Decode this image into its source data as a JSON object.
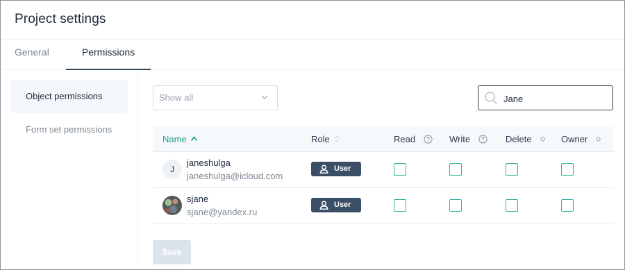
{
  "header": {
    "title": "Project settings"
  },
  "tabs": [
    {
      "label": "General",
      "active": false
    },
    {
      "label": "Permissions",
      "active": true
    }
  ],
  "sidebar": {
    "items": [
      {
        "label": "Object permissions",
        "active": true
      },
      {
        "label": "Form set permissions",
        "active": false
      }
    ]
  },
  "filter": {
    "selected": "Show all"
  },
  "search": {
    "value": "Jane"
  },
  "table": {
    "columns": [
      "Name",
      "Role",
      "Read",
      "Write",
      "Delete",
      "Owner"
    ],
    "sort": {
      "column": "Name",
      "direction": "asc"
    },
    "rows": [
      {
        "avatar_text": "J",
        "username": "janeshulga",
        "email": "janeshulga@icloud.com",
        "role": "User",
        "read": false,
        "write": false,
        "delete": false,
        "owner": false
      },
      {
        "avatar_text": "",
        "username": "sjane",
        "email": "sjane@yandex.ru",
        "role": "User",
        "read": false,
        "write": false,
        "delete": false,
        "owner": false
      }
    ]
  },
  "actions": {
    "save_label": "Save",
    "save_disabled": true
  },
  "colors": {
    "accent": "#1e9e8c",
    "checkbox_border": "#2bb3a0",
    "role_badge": "#3a4f66",
    "save_disabled_bg": "#dbe3ec"
  },
  "icons": {
    "filter_chevron": "chevron-down-icon",
    "search": "search-icon",
    "sort": "sort-ascending-icon",
    "help": "help-circle-icon",
    "role": "user-icon"
  }
}
